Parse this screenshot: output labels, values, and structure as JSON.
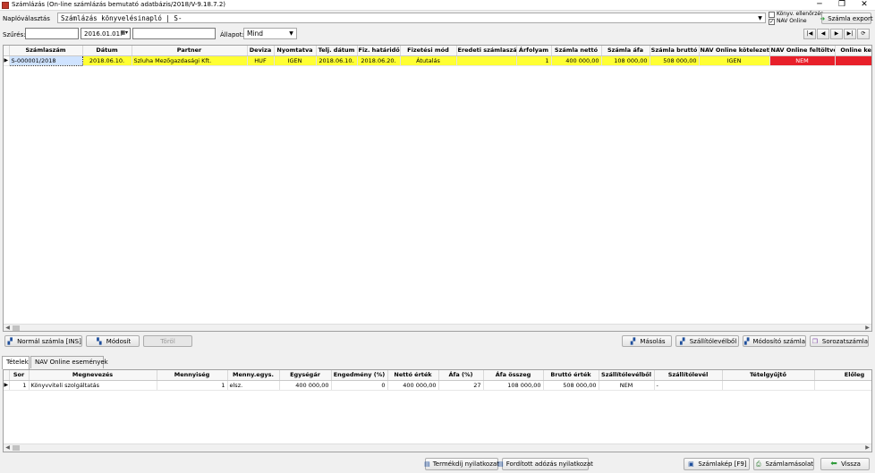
{
  "window": {
    "title": "Számlázás (On-line számlázás bemutató adatbázis/2018/V-9.18.7.2)",
    "minimize": "─",
    "restore": "❐",
    "close": "✕"
  },
  "toolbar": {
    "journal_label": "Naplóválasztás",
    "journal_value": "Számlázás könyvelésinapló | S-",
    "konyv_ellenorzes": "Könyv. ellenőrzés",
    "nav_online": "NAV Online",
    "nav_online_checked": "✓",
    "export_button": "Számla export"
  },
  "filter": {
    "label": "Szűrés:",
    "text_value": "",
    "date_value": "2016.01.01.",
    "text2_value": "",
    "status_label": "Állapot:",
    "status_value": "Mind"
  },
  "nav_buttons": [
    "|◀",
    "◀",
    "▶",
    "▶|",
    "⟳"
  ],
  "invoice_table": {
    "columns": [
      "Számlaszám",
      "Dátum",
      "Partner",
      "Deviza",
      "Nyomtatva",
      "Telj. dátum",
      "Fiz. határidő",
      "Fizetési mód",
      "Eredeti számlaszám",
      "Árfolyam",
      "Számla nettó",
      "Számla áfa",
      "Számla bruttó",
      "NAV Online kötelezett",
      "NAV Online feltöltve",
      "Online kezzel fe"
    ],
    "rows": [
      {
        "indicator": "▶",
        "szamlaszam": "S-000001/2018",
        "datum": "2018.06.10.",
        "partner": "Szluha Mezőgazdasági Kft.",
        "deviza": "HUF",
        "nyomtatva": "IGEN",
        "telj_datum": "2018.06.10.",
        "fiz_hatarido": "2018.06.20.",
        "fizetesi_mod": "Átutalás",
        "eredeti": "",
        "arfolyam": "1",
        "netto": "400 000,00",
        "afa": "108 000,00",
        "brutto": "508 000,00",
        "kotelezett": "IGEN",
        "feltoltve": "NEM",
        "kezzel": ""
      }
    ]
  },
  "actions": {
    "normal_szamla": "Normál számla [INS]",
    "modosit": "Módosít",
    "torol": "Töröl",
    "masolas": "Másolás",
    "szallitolevelbol": "Szállítólevélből",
    "modosito_szamla": "Módosító számla",
    "sorozatszamla": "Sorozatszámla"
  },
  "tabs": [
    "Tételek",
    "NAV Online események"
  ],
  "items_table": {
    "columns": [
      "Sor",
      "Megnevezés",
      "Mennyiség",
      "Menny.egys.",
      "Egységár",
      "Engedmény (%)",
      "Nettó érték",
      "Áfa (%)",
      "Áfa összeg",
      "Bruttó érték",
      "Szállítólevélből",
      "Szállítólevél",
      "Tételgyűjtő",
      "Előleg"
    ],
    "rows": [
      {
        "indicator": "▶",
        "sor": "1",
        "megnevezes": "Könyvviteli szolgáltatás",
        "mennyiseg": "1",
        "egyseg": "elsz.",
        "egysegar": "400 000,00",
        "engedmeny": "0",
        "netto": "400 000,00",
        "afa_pct": "27",
        "afa_osszeg": "108 000,00",
        "brutto": "508 000,00",
        "szallitolevelbol": "NEM",
        "szallitolevel": "-",
        "tetelgyujto": "",
        "eloleg": ""
      }
    ]
  },
  "footer": {
    "termekdij": "Termékdíj nyilatkozat",
    "forditott": "Fordított adózás nyilatkozat",
    "szamlakep": "Számlakép [F9]",
    "szamlamasolat": "Számlamásolat",
    "vissza": "Vissza"
  },
  "colors": {
    "selected_row": "#ffff33",
    "nav_not_uploaded": "#e8202a",
    "export_icon": "#2e9b3a",
    "vissza_icon": "#2e9b3a"
  }
}
